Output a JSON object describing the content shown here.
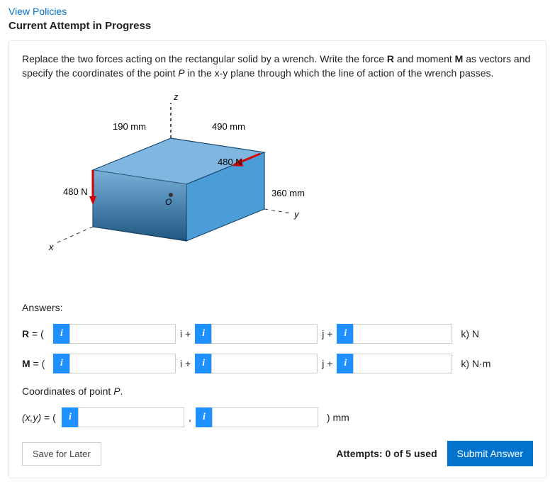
{
  "header": {
    "view_policies": "View Policies",
    "progress_title": "Current Attempt in Progress"
  },
  "question": {
    "prefix": "Replace the two forces acting on the rectangular solid by a wrench. Write the force ",
    "R": "R",
    "mid1": " and moment ",
    "M": "M",
    "mid2": " as vectors and specify the coordinates of the point ",
    "P": "P",
    "suffix": " in the x-y plane through which the line of action of the wrench passes."
  },
  "diagram": {
    "dim_190": "190 mm",
    "dim_490": "490 mm",
    "dim_360": "360 mm",
    "force_480_left": "480 N",
    "force_480_top": "480 N",
    "axis_x": "x",
    "axis_y": "y",
    "axis_z": "z",
    "origin": "O"
  },
  "answers": {
    "label": "Answers:",
    "R_label": "R",
    "M_label": "M",
    "eq_open": " = ( ",
    "i_plus": "i + ",
    "j_plus": "j + ",
    "unit_R": "k) N",
    "unit_M": "k) N·m",
    "coords_label": "Coordinates of point ",
    "coords_P": "P",
    "coords_period": ".",
    "xy_label": "(x,y)",
    "xy_eq": " = ( ",
    "close_unit": ") mm",
    "info_icon": "i"
  },
  "footer": {
    "save": "Save for Later",
    "attempts": "Attempts: 0 of 5 used",
    "submit": "Submit Answer"
  }
}
